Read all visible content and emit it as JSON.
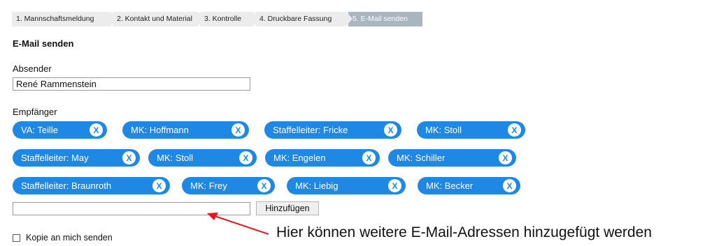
{
  "steps": [
    {
      "label": "1. Mannschaftsmeldung"
    },
    {
      "label": "2. Kontakt und Material"
    },
    {
      "label": "3. Kontrolle"
    },
    {
      "label": "4. Druckbare Fassung"
    },
    {
      "label": "5. E-Mail senden"
    }
  ],
  "active_step": "5. E-Mail senden",
  "title": "E-Mail senden",
  "sender": {
    "label": "Absender",
    "value": "René Rammenstein"
  },
  "recipients": {
    "label": "Empfänger",
    "chips": [
      {
        "label": "VA: Teille"
      },
      {
        "label": "MK: Hoffmann"
      },
      {
        "label": "Staffelleiter: Fricke"
      },
      {
        "label": "MK: Stoll"
      },
      {
        "label": "Staffelleiter: May"
      },
      {
        "label": "MK: Stoll"
      },
      {
        "label": "MK: Engelen"
      },
      {
        "label": "MK: Schiller"
      },
      {
        "label": "Staffelleiter: Braunroth"
      },
      {
        "label": "MK: Frey"
      },
      {
        "label": "MK: Liebig"
      },
      {
        "label": "MK: Becker"
      }
    ],
    "remove_symbol": "X"
  },
  "add": {
    "value": "",
    "button_label": "Hinzufügen"
  },
  "copy_checkbox": {
    "label": "Kopie an mich senden",
    "checked": false
  },
  "annotation": {
    "text": "Hier können weitere E-Mail-Adressen hinzugefügt werden",
    "color": "#e5161e"
  },
  "colors": {
    "chip": "#1f88e5",
    "active_step": "#a8b6bf"
  }
}
